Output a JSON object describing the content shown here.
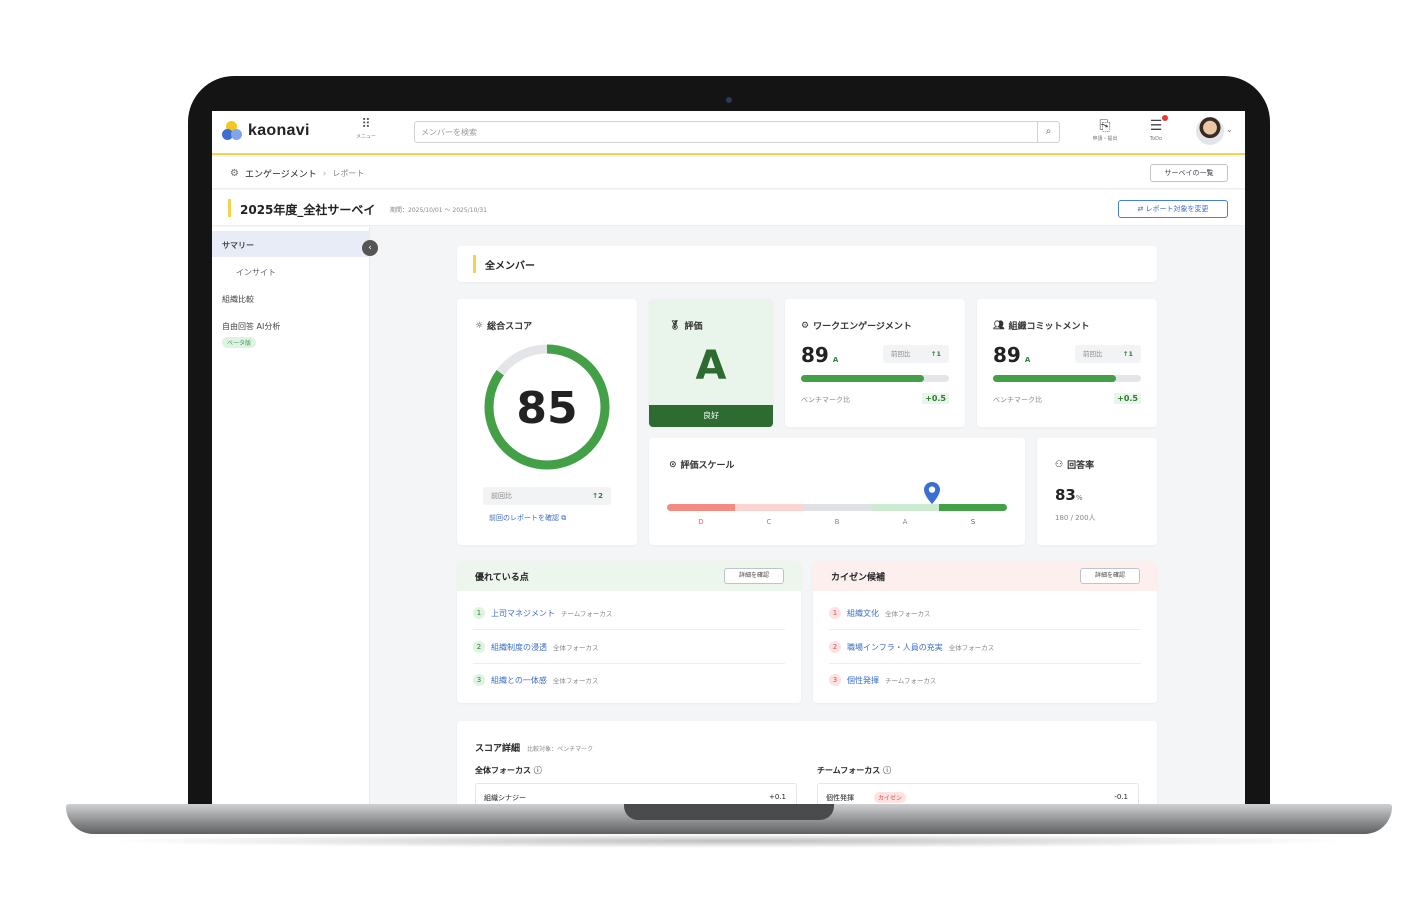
{
  "app": {
    "logo_text": "kaonavi",
    "menu_label": "メニュー",
    "search_placeholder": "メンバーを検索"
  },
  "topbar": {
    "apply_label": "申請・提出",
    "todo_label": "ToDo"
  },
  "breadcrumb": {
    "root": "エンゲージメント",
    "sep": "›",
    "current": "レポート"
  },
  "survey_list_button": "サーベイの一覧",
  "page": {
    "title": "2025年度_全社サーベイ",
    "period": "期間：2025/10/01 ～ 2025/10/31",
    "change_target_button": "レポート対象を変更"
  },
  "sidebar": {
    "items": [
      "サマリー",
      "インサイト",
      "組織比較",
      "自由回答 AI分析"
    ],
    "beta_badge": "ベータ版"
  },
  "section_title": "全メンバー",
  "overall": {
    "label": "総合スコア",
    "score": "85",
    "score_fraction": 0.85,
    "prev_label": "前回比",
    "prev_delta": "↑2",
    "prev_link": "前回のレポートを確認 ⧉"
  },
  "rating": {
    "label": "評価",
    "grade": "A",
    "status": "良好"
  },
  "work_engagement": {
    "label": "ワークエンゲージメント",
    "score": "89",
    "grade": "A",
    "prev_label": "前回比",
    "prev_delta": "↑1",
    "fill": 0.83,
    "bench_label": "ベンチマーク比",
    "bench_delta": "+0.5"
  },
  "org_commitment": {
    "label": "組織コミットメント",
    "score": "89",
    "grade": "A",
    "prev_label": "前回比",
    "prev_delta": "↑1",
    "fill": 0.83,
    "bench_label": "ベンチマーク比",
    "bench_delta": "+0.5"
  },
  "scale": {
    "label": "評価スケール",
    "grades": [
      "D",
      "C",
      "B",
      "A",
      "S"
    ],
    "marker_position": 0.78,
    "colors": [
      "#f28b82",
      "#fbd3d0",
      "#dfe1e5",
      "#cdebd1",
      "#43a047"
    ]
  },
  "response": {
    "label": "回答率",
    "rate": "83",
    "unit": "%",
    "count": "180 / 200人"
  },
  "strengths": {
    "title": "優れている点",
    "button": "詳細を確認",
    "items": [
      {
        "no": "1",
        "name": "上司マネジメント",
        "tag": "チームフォーカス"
      },
      {
        "no": "2",
        "name": "組織制度の浸透",
        "tag": "全体フォーカス"
      },
      {
        "no": "3",
        "name": "組織との一体感",
        "tag": "全体フォーカス"
      }
    ]
  },
  "improvements": {
    "title": "カイゼン候補",
    "button": "詳細を確認",
    "items": [
      {
        "no": "1",
        "name": "組織文化",
        "tag": "全体フォーカス"
      },
      {
        "no": "2",
        "name": "職場インフラ・人員の充実",
        "tag": "全体フォーカス"
      },
      {
        "no": "3",
        "name": "個性発揮",
        "tag": "チームフォーカス"
      }
    ]
  },
  "score_detail": {
    "title": "スコア詳細",
    "compare": "比較対象：ベンチマーク",
    "left_heading": "全体フォーカス",
    "right_heading": "チームフォーカス",
    "left_row": {
      "name": "組織シナジー",
      "value": "+0.1"
    },
    "right_row": {
      "name": "個性発揮",
      "badge": "カイゼン",
      "value": "-0.1"
    }
  },
  "colors": {
    "accent_yellow": "#f3d34a",
    "green": "#43a047",
    "blue": "#3a6cc8",
    "red": "#e53935"
  }
}
